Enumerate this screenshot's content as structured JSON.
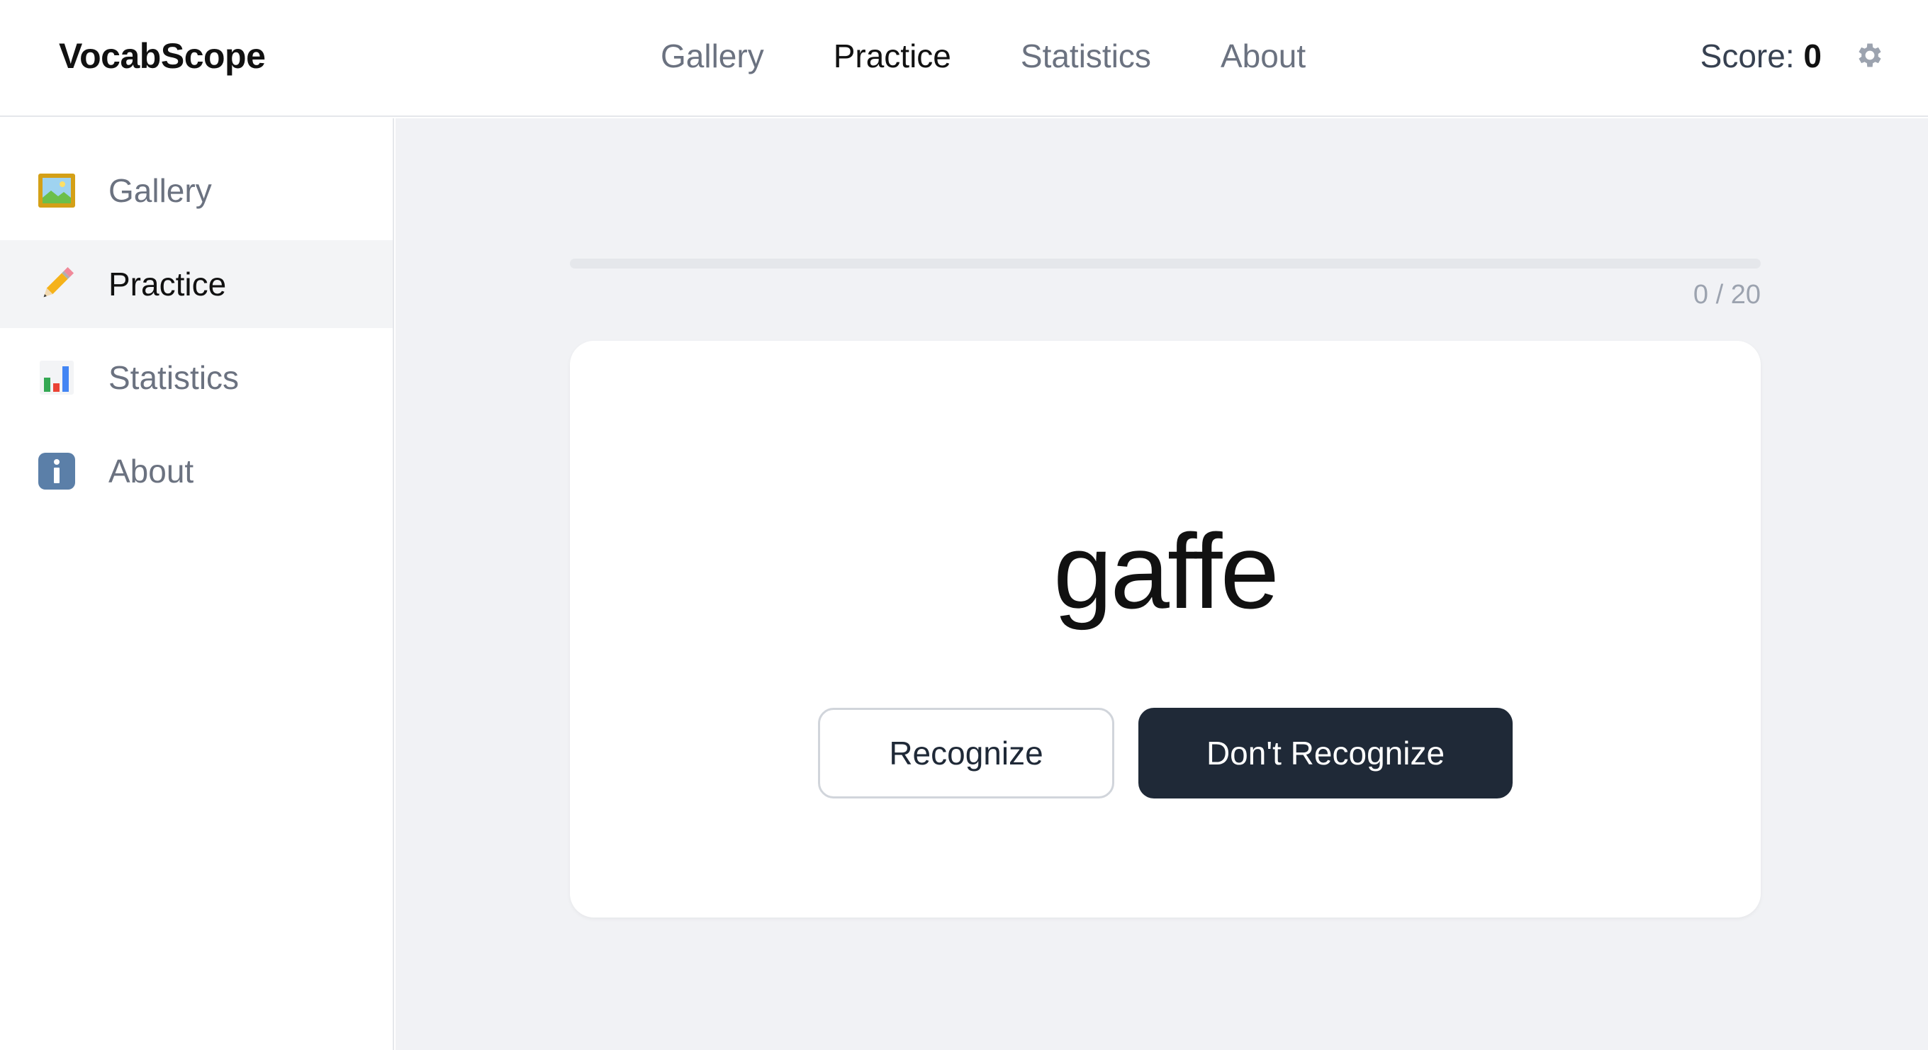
{
  "brand": "VocabScope",
  "topnav": [
    {
      "label": "Gallery",
      "active": false
    },
    {
      "label": "Practice",
      "active": true
    },
    {
      "label": "Statistics",
      "active": false
    },
    {
      "label": "About",
      "active": false
    }
  ],
  "score": {
    "label": "Score:",
    "value": "0"
  },
  "sidebar": {
    "items": [
      {
        "label": "Gallery",
        "icon": "framed-picture-icon",
        "active": false
      },
      {
        "label": "Practice",
        "icon": "pencil-icon",
        "active": true
      },
      {
        "label": "Statistics",
        "icon": "bar-chart-icon",
        "active": false
      },
      {
        "label": "About",
        "icon": "info-icon",
        "active": false
      }
    ]
  },
  "practice": {
    "progress_text": "0 / 20",
    "progress_fraction": 0,
    "word": "gaffe",
    "recognize_label": "Recognize",
    "dont_recognize_label": "Don't Recognize"
  },
  "colors": {
    "accent_dark": "#1f2937",
    "background": "#f1f2f5",
    "muted_text": "#6b7280"
  }
}
